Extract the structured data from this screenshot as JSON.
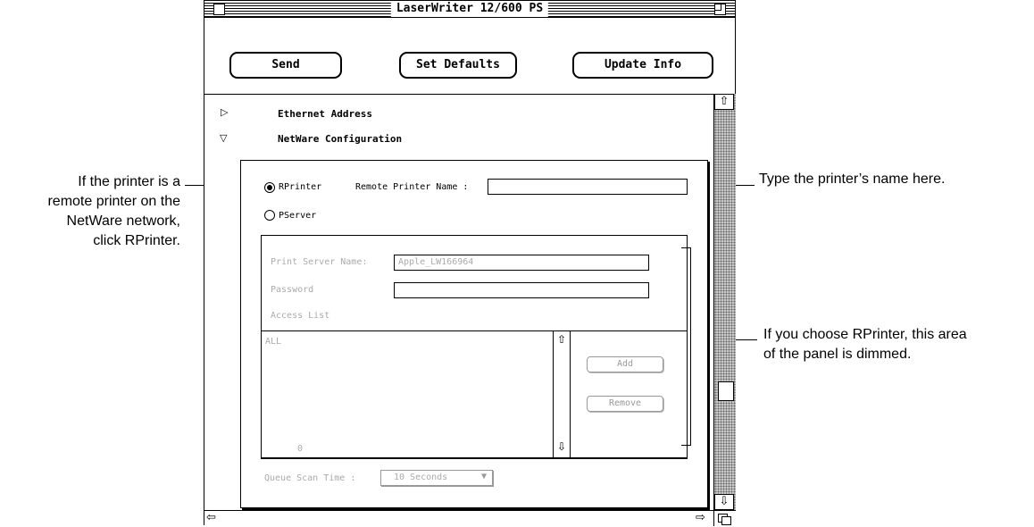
{
  "window": {
    "title": "LaserWriter 12/600 PS"
  },
  "toolbar": {
    "send": "Send",
    "set_defaults": "Set Defaults",
    "update_info": "Update Info"
  },
  "sections": [
    {
      "label": "Ethernet Address",
      "expanded": false
    },
    {
      "label": "NetWare Configuration",
      "expanded": true
    }
  ],
  "netware": {
    "rprinter_label": "RPrinter",
    "remote_printer_name_label": "Remote Printer Name :",
    "remote_printer_name_value": "",
    "pserver_label": "PServer",
    "print_server_name_label": "Print Server Name:",
    "print_server_name_value": "Apple_LW166964",
    "password_label": "Password",
    "password_value": "",
    "access_list_label": "Access List",
    "access_list_items": [
      "ALL"
    ],
    "access_list_footer": "0",
    "add_button": "Add",
    "remove_button": "Remove",
    "queue_scan_label": "Queue Scan Time :",
    "queue_scan_value": "10 Seconds",
    "selected_mode": "RPrinter"
  },
  "callouts": {
    "left": [
      "If the printer is a",
      "remote printer on the",
      "NetWare network,",
      "click RPrinter."
    ],
    "top_right": "Type the printer’s name here.",
    "bottom_right": [
      "If you choose RPrinter, this area",
      "of the panel is dimmed."
    ]
  }
}
